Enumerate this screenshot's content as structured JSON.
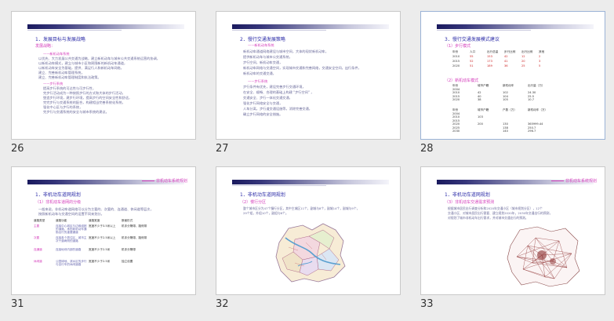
{
  "slides": [
    {
      "number": "26",
      "heading": "1．发展目标与发展战略",
      "sub1": "发展战略：",
      "sub2": "——新机动车系统",
      "lines": [
        "以优先、大力发展公共交通为战略，建立新机动车与城市公共交通系统运营的协调，",
        "以新机动车模式，建立与城市小区和周围新的新机动车通道，",
        "以新机动车安全为基础，提供、满足行人和新机动车网络，",
        "建立、完善新机动车管理系统，",
        "建立、完善新机动车管理制度和执法政策。"
      ],
      "sub3": "——步行系统",
      "lines2": [
        "提高步行系统的可达性与可步行性，",
        "完步行活动成为一种按照步行的方式和大体的步行活动，",
        "塑造步行环境，建步行环境，提高步行的空间安全性和舒适，",
        "完完步行与交通系统的配合，构建相当完善系统化系统，",
        "强化中心区与步行的系统，",
        "完步行与交通系统的安全与城市系统的建议。"
      ]
    },
    {
      "number": "27",
      "heading": "2．慢行交通发展策略",
      "sub1": "——新机动车系统",
      "lines": [
        "新机动车通道网络建设与城市空间，大体的现状新机动车，",
        "提供新机动车与城市公交通系统，",
        "步行空间，新机动车交通，",
        "新机动车网络与交通空间，实现城市交通和完善网络，交通安全空间，出行条件，",
        "新机动车的交通交通，"
      ],
      "sub2": "——步行系统",
      "lines2": [
        "步行条件有优先，建设完善步行交通环境，",
        "在安全、顺畅、合理的基础上构建 \"步行空间\" ，",
        "交通安全、步行一体化交通交通，",
        "强化步行网络安全与交通，",
        "人车分离，步行道交通设施等，消除完善交通，",
        "确立步行网络的安全措施。"
      ]
    },
    {
      "number": "28",
      "heading": "3．慢行交通发展模式建议",
      "sub1": "（1）步行模式",
      "table1": {
        "header": [
          "年份",
          "人口",
          "出行总量",
          "步行比例",
          "出行比例",
          "其他"
        ],
        "rows": [
          [
            "2010",
            "55",
            "153",
            "42",
            "12",
            "2"
          ],
          [
            "2015",
            "52",
            "173",
            "41",
            "20",
            "3"
          ],
          [
            "2020",
            "51",
            "189",
            "36",
            "25",
            "5"
          ]
        ]
      },
      "sub2": "（2）新机动车模式",
      "table2": {
        "header": [
          "年份",
          "城市户籍",
          "新机动车",
          "出行量（万）"
        ],
        "rows": [
          [
            "2004",
            "",
            "",
            ""
          ],
          [
            "2010",
            "42",
            "102",
            "24.30"
          ],
          [
            "2015",
            "40",
            "104",
            "25.5"
          ],
          [
            "2020",
            "38",
            "105",
            "10.7"
          ]
        ]
      },
      "table3": {
        "header": [
          "年份",
          "城市户籍",
          "户数（万）",
          "新机动车（万）"
        ],
        "rows": [
          [
            "2004",
            "",
            "",
            ""
          ],
          [
            "2010",
            "103",
            "",
            ""
          ],
          [
            "2015",
            "",
            "",
            ""
          ],
          [
            "2020",
            "200",
            "130",
            "365999.44"
          ],
          [
            "2025",
            "",
            "138",
            "250.7"
          ],
          [
            "2030",
            "",
            "140",
            "296.7"
          ]
        ]
      }
    },
    {
      "number": "31",
      "toplink": "非机动车系统规划",
      "heading": "1．非机动车道网规划",
      "sub1": "（1）非机动车道网的分级",
      "lines": [
        "一般来说，非机动车道网络可以分为主要的、次要的、连通道、休闲道等层次，",
        "按照新机动车与交通空间的设置不同来划分。"
      ],
      "table": {
        "header": [
          "道路类型",
          "道路功能",
          "道路宽度",
          "断面形式"
        ],
        "rows": [
          [
            "主要",
            "连接中心城区与边缘组团的道路，承担新机动车通勤出行的重要通道",
            "宽度不少于3.5米以上",
            "机非分隔带、路侧带"
          ],
          [
            "次要",
            "连接各个居住区，城市主次干道两侧的道路",
            "宽度不少于2.5米以上",
            "机非分隔带、路侧带"
          ],
          [
            "连通道",
            "连接地块内部的道路",
            "宽度不少于2.5米",
            "机非分隔带"
          ],
          [
            "休闲道",
            "公园绿地、滨水区的步行与自行车的休闲道路",
            "宽度不少于2.5米",
            "独立设置"
          ]
        ]
      }
    },
    {
      "number": "32",
      "heading": "1．非机动车道网规划",
      "sub1": "（2）慢行分区",
      "lines": [
        "整个城市区分为47个慢行分区，其中主城区11个，副城与8个，副城14个，副城与9个，",
        "29个组，外组10个，副组与6个。"
      ]
    },
    {
      "number": "33",
      "toplink": "非机动车系统规划",
      "heading": "1．非机动车道网规划",
      "sub1": "（3）非机动车交通需求预测",
      "lines": [
        "根据城市居民出行调查分析和2020年交通小区（城市规划分区），12个",
        "交通小区、对城市居民出行需要、建立规划2020年，2030年交通出行的预测，",
        "对规划了城市非机动车出行需求，并对城市交通出行的预测。"
      ]
    }
  ],
  "colors": {
    "heading": "#2c2ca8",
    "accent": "#d43dbb",
    "body_text": "#6a6a9a"
  }
}
